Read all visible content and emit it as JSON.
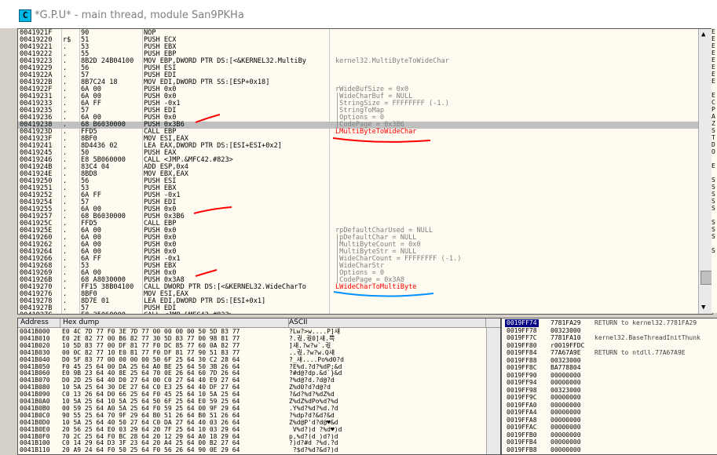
{
  "window": {
    "icon_letter": "C",
    "title": "*G.P.U* - main thread, module San9PKHa"
  },
  "cpu": {
    "rows": [
      {
        "addr": "0041921F",
        "br": "",
        "hex": "90",
        "dis": "NOP",
        "com": "",
        "hl": false,
        "red": false
      },
      {
        "addr": "00419220",
        "br": "r$",
        "hex": "51",
        "dis": "PUSH ECX",
        "com": ""
      },
      {
        "addr": "00419221",
        "br": ".",
        "hex": "53",
        "dis": "PUSH EBX",
        "com": ""
      },
      {
        "addr": "00419222",
        "br": ".",
        "hex": "55",
        "dis": "PUSH EBP",
        "com": ""
      },
      {
        "addr": "00419223",
        "br": ".",
        "hex": "8B2D 24B04100",
        "dis": "MOV EBP,DWORD PTR DS:[<&KERNEL32.MultiBy",
        "com": "kernel32.MultiByteToWideChar"
      },
      {
        "addr": "00419229",
        "br": ".",
        "hex": "56",
        "dis": "PUSH ESI",
        "com": ""
      },
      {
        "addr": "0041922A",
        "br": ".",
        "hex": "57",
        "dis": "PUSH EDI",
        "com": ""
      },
      {
        "addr": "0041922B",
        "br": ".",
        "hex": "8B7C24 18",
        "dis": "MOV EDI,DWORD PTR SS:[ESP+0x18]",
        "com": ""
      },
      {
        "addr": "0041922F",
        "br": ".",
        "hex": "6A 00",
        "dis": "PUSH 0x0",
        "com": "rWideBufSize = 0x0"
      },
      {
        "addr": "00419231",
        "br": ".",
        "hex": "6A 00",
        "dis": "PUSH 0x0",
        "com": "|WideCharBuf = NULL"
      },
      {
        "addr": "00419233",
        "br": ".",
        "hex": "6A FF",
        "dis": "PUSH -0x1",
        "com": "|StringSize = FFFFFFFF (-1.)"
      },
      {
        "addr": "00419235",
        "br": ".",
        "hex": "57",
        "dis": "PUSH EDI",
        "com": "|StringToMap"
      },
      {
        "addr": "00419236",
        "br": ".",
        "hex": "6A 00",
        "dis": "PUSH 0x0",
        "com": "|Options = 0"
      },
      {
        "addr": "00419238",
        "br": ".",
        "hex": "68 B6030000",
        "dis": "PUSH 0x3B6",
        "com": "|CodePage = 0x3B6",
        "hl": true
      },
      {
        "addr": "0041923D",
        "br": ".",
        "hex": "FFD5",
        "dis": "CALL EBP",
        "com": "LMultiByteToWideChar",
        "red": true
      },
      {
        "addr": "0041923F",
        "br": ".",
        "hex": "8BF0",
        "dis": "MOV ESI,EAX",
        "com": ""
      },
      {
        "addr": "00419241",
        "br": ".",
        "hex": "8D4436 02",
        "dis": "LEA EAX,DWORD PTR DS:[ESI+ESI+0x2]",
        "com": ""
      },
      {
        "addr": "00419245",
        "br": ".",
        "hex": "50",
        "dis": "PUSH EAX",
        "com": ""
      },
      {
        "addr": "00419246",
        "br": ".",
        "hex": "E8 5B060000",
        "dis": "CALL <JMP.&MFC42.#823>",
        "com": ""
      },
      {
        "addr": "0041924B",
        "br": ".",
        "hex": "83C4 04",
        "dis": "ADD ESP,0x4",
        "com": ""
      },
      {
        "addr": "0041924E",
        "br": ".",
        "hex": "8BD8",
        "dis": "MOV EBX,EAX",
        "com": ""
      },
      {
        "addr": "00419250",
        "br": ".",
        "hex": "56",
        "dis": "PUSH ESI",
        "com": ""
      },
      {
        "addr": "00419251",
        "br": ".",
        "hex": "53",
        "dis": "PUSH EBX",
        "com": ""
      },
      {
        "addr": "00419252",
        "br": ".",
        "hex": "6A FF",
        "dis": "PUSH -0x1",
        "com": ""
      },
      {
        "addr": "00419254",
        "br": ".",
        "hex": "57",
        "dis": "PUSH EDI",
        "com": ""
      },
      {
        "addr": "00419255",
        "br": ".",
        "hex": "6A 00",
        "dis": "PUSH 0x0",
        "com": ""
      },
      {
        "addr": "00419257",
        "br": ".",
        "hex": "68 B6030000",
        "dis": "PUSH 0x3B6",
        "com": ""
      },
      {
        "addr": "0041925C",
        "br": ".",
        "hex": "FFD5",
        "dis": "CALL EBP",
        "com": ""
      },
      {
        "addr": "0041925E",
        "br": ".",
        "hex": "6A 00",
        "dis": "PUSH 0x0",
        "com": "rpDefaultCharUsed = NULL"
      },
      {
        "addr": "00419260",
        "br": ".",
        "hex": "6A 00",
        "dis": "PUSH 0x0",
        "com": "|pDefaultChar = NULL"
      },
      {
        "addr": "00419262",
        "br": ".",
        "hex": "6A 00",
        "dis": "PUSH 0x0",
        "com": "|MultiByteCount = 0x0"
      },
      {
        "addr": "00419264",
        "br": ".",
        "hex": "6A 00",
        "dis": "PUSH 0x0",
        "com": "|MultiByteStr = NULL"
      },
      {
        "addr": "00419266",
        "br": ".",
        "hex": "6A FF",
        "dis": "PUSH -0x1",
        "com": "|WideCharCount = FFFFFFFF (-1.)"
      },
      {
        "addr": "00419268",
        "br": ".",
        "hex": "53",
        "dis": "PUSH EBX",
        "com": "|WideCharStr"
      },
      {
        "addr": "00419269",
        "br": ".",
        "hex": "6A 00",
        "dis": "PUSH 0x0",
        "com": "|Options = 0"
      },
      {
        "addr": "0041926B",
        "br": ".",
        "hex": "68 A8030000",
        "dis": "PUSH 0x3A8",
        "com": "|CodePage = 0x3A8"
      },
      {
        "addr": "00419270",
        "br": ".",
        "hex": "FF15 38B04100",
        "dis": "CALL DWORD PTR DS:[<&KERNEL32.WideCharTo",
        "com": "LWideCharToMultiByte",
        "red": true
      },
      {
        "addr": "00419276",
        "br": ".",
        "hex": "8BF0",
        "dis": "MOV ESI,EAX",
        "com": ""
      },
      {
        "addr": "00419278",
        "br": ".",
        "hex": "8D7E 01",
        "dis": "LEA EDI,DWORD PTR DS:[ESI+0x1]",
        "com": ""
      },
      {
        "addr": "0041927B",
        "br": ".",
        "hex": "57",
        "dis": "PUSH EDI",
        "com": ""
      },
      {
        "addr": "0041927C",
        "br": ".",
        "hex": "E8 25060000",
        "dis": "CALL <JMP.&MFC42.#823>",
        "com": ""
      }
    ],
    "scroll_up": "▲",
    "scroll_down": "▼"
  },
  "registers_letters": [
    "E",
    "E",
    "E",
    "E",
    "E",
    "E",
    "E",
    "E",
    "",
    "E",
    "C",
    "P",
    "A",
    "Z",
    "S",
    "T",
    "D",
    "O",
    "",
    "E",
    "",
    "S",
    "S",
    "S",
    "S",
    "S",
    "",
    "S",
    "S",
    "S",
    "",
    "S",
    "",
    "",
    "",
    "",
    "",
    "",
    "",
    "",
    ""
  ],
  "dump": {
    "headers": {
      "address": "Address",
      "hex": "Hex dump",
      "ascii": "ASCII"
    },
    "rows": [
      {
        "addr": "0041B000",
        "hex": "E0 4C 7D 77 F0 3E 7D 77 00 00 00 00 50 5D 83 77",
        "asc": "?Lw?>w....P]섀"
      },
      {
        "addr": "0041B010",
        "hex": "E0 2E 82 77 00 B6 82 77 30 5D 83 77 00 98 81 77",
        "asc": "?.궋.궋0]섀.쁙"
      },
      {
        "addr": "0041B020",
        "hex": "10 5D 83 77 00 DF 81 77 F0 DC 85 77 60 0A 82 77",
        "asc": "]섀.?w?w`.궋"
      },
      {
        "addr": "0041B030",
        "hex": "00 0C 82 77 10 E0 81 77 F0 DF 81 77 90 51 83 77",
        "asc": "..궋.?w?w.Q섀"
      },
      {
        "addr": "0041B040",
        "hex": "D0 5F 83 77 00 00 00 00 50 6F 25 64 30 C2 28 64",
        "asc": "?_섀....Po%d0?d"
      },
      {
        "addr": "0041B050",
        "hex": "F0 45 25 64 00 DA 25 64 A0 BE 25 64 50 3B 26 64",
        "asc": "?E%d.?d?%dP;&d"
      },
      {
        "addr": "0041B060",
        "hex": "E0 9B 23 64 40 8E 25 64 70 0E 26 64 60 7D 26 64",
        "asc": "?#d@?dp.&d`}&d"
      },
      {
        "addr": "0041B070",
        "hex": "D0 2D 25 64 40 D0 27 64 00 C0 27 64 40 E9 27 64",
        "asc": "?%d@?d.?d@?d"
      },
      {
        "addr": "0041B080",
        "hex": "10 5A 25 64 30 DE 27 64 C0 E3 25 64 40 DF 27 64",
        "asc": "Z%d0?d?d@?d"
      },
      {
        "addr": "0041B090",
        "hex": "C0 13 26 64 D0 66 25 64 F0 45 25 64 10 5A 25 64",
        "asc": "?&d?%d?%dZ%d"
      },
      {
        "addr": "0041B0A0",
        "hex": "10 5A 25 64 10 5A 25 64 50 6F 25 64 E0 59 25 64",
        "asc": "Z%dZ%dPo%d?%d"
      },
      {
        "addr": "0041B0B0",
        "hex": "00 59 25 64 A0 5A 25 64 F0 59 25 64 00 9F 29 64",
        "asc": ".Y%d?%d?%d.?d"
      },
      {
        "addr": "0041B0C0",
        "hex": "90 55 25 64 70 9F 29 64 B0 51 26 64 B0 51 26 64",
        "asc": "?%dp?d?&d?&d"
      },
      {
        "addr": "0041B0D0",
        "hex": "10 5A 25 64 40 50 27 64 C0 DA 27 64 40 03 26 64",
        "asc": "Z%d@P'd?d@♥&d"
      },
      {
        "addr": "0041B0E0",
        "hex": "20 56 25 64 E0 03 29 64 20 7F 25 64 10 03 29 64",
        "asc": " V%d?)d ?%d♥)d"
      },
      {
        "addr": "0041B0F0",
        "hex": "70 2C 25 64 F0 BC 28 64 20 12 29 64 A0 18 29 64",
        "asc": "p,%d?(d )d?)d"
      },
      {
        "addr": "0041B100",
        "hex": "C0 14 29 64 D3 3F 23 64 20 A4 25 64 00 B2 27 64",
        "asc": "?)d?#d ?%d.?d"
      },
      {
        "addr": "0041B110",
        "hex": "20 A9 24 64 F0 50 25 64 F0 56 26 64 90 0E 29 64",
        "asc": " ?$d?%d?&d?)d"
      }
    ]
  },
  "stack": {
    "rows": [
      {
        "addr": "0019FF74",
        "val": "7781FA29",
        "com": "RETURN to kernel32.7781FA29",
        "sel": true
      },
      {
        "addr": "0019FF78",
        "val": "00323000",
        "com": ""
      },
      {
        "addr": "0019FF7C",
        "val": "7781FA10",
        "com": "kernel32.BaseThreadInitThunk"
      },
      {
        "addr": "0019FF80",
        "val": "r0019FFDC",
        "com": ""
      },
      {
        "addr": "0019FF84",
        "val": "77A67A9E",
        "com": "RETURN to ntdll.77A67A9E"
      },
      {
        "addr": "0019FF88",
        "val": "00323000",
        "com": ""
      },
      {
        "addr": "0019FF8C",
        "val": "BA778804",
        "com": ""
      },
      {
        "addr": "0019FF90",
        "val": "00000000",
        "com": ""
      },
      {
        "addr": "0019FF94",
        "val": "00000000",
        "com": ""
      },
      {
        "addr": "0019FF98",
        "val": "00323000",
        "com": ""
      },
      {
        "addr": "0019FF9C",
        "val": "00000000",
        "com": ""
      },
      {
        "addr": "0019FFA0",
        "val": "00000000",
        "com": ""
      },
      {
        "addr": "0019FFA4",
        "val": "00000000",
        "com": ""
      },
      {
        "addr": "0019FFA8",
        "val": "00000000",
        "com": ""
      },
      {
        "addr": "0019FFAC",
        "val": "00000000",
        "com": ""
      },
      {
        "addr": "0019FFB0",
        "val": "00000000",
        "com": ""
      },
      {
        "addr": "0019FFB4",
        "val": "00000000",
        "com": ""
      },
      {
        "addr": "0019FFB8",
        "val": "00000000",
        "com": ""
      }
    ]
  },
  "colors": {
    "highlight_row": "#c0c0c0",
    "comment_red": "#ff0000",
    "annotation_red": "#ff0000",
    "annotation_blue": "#0090ff",
    "stack_selected": "#000080"
  }
}
